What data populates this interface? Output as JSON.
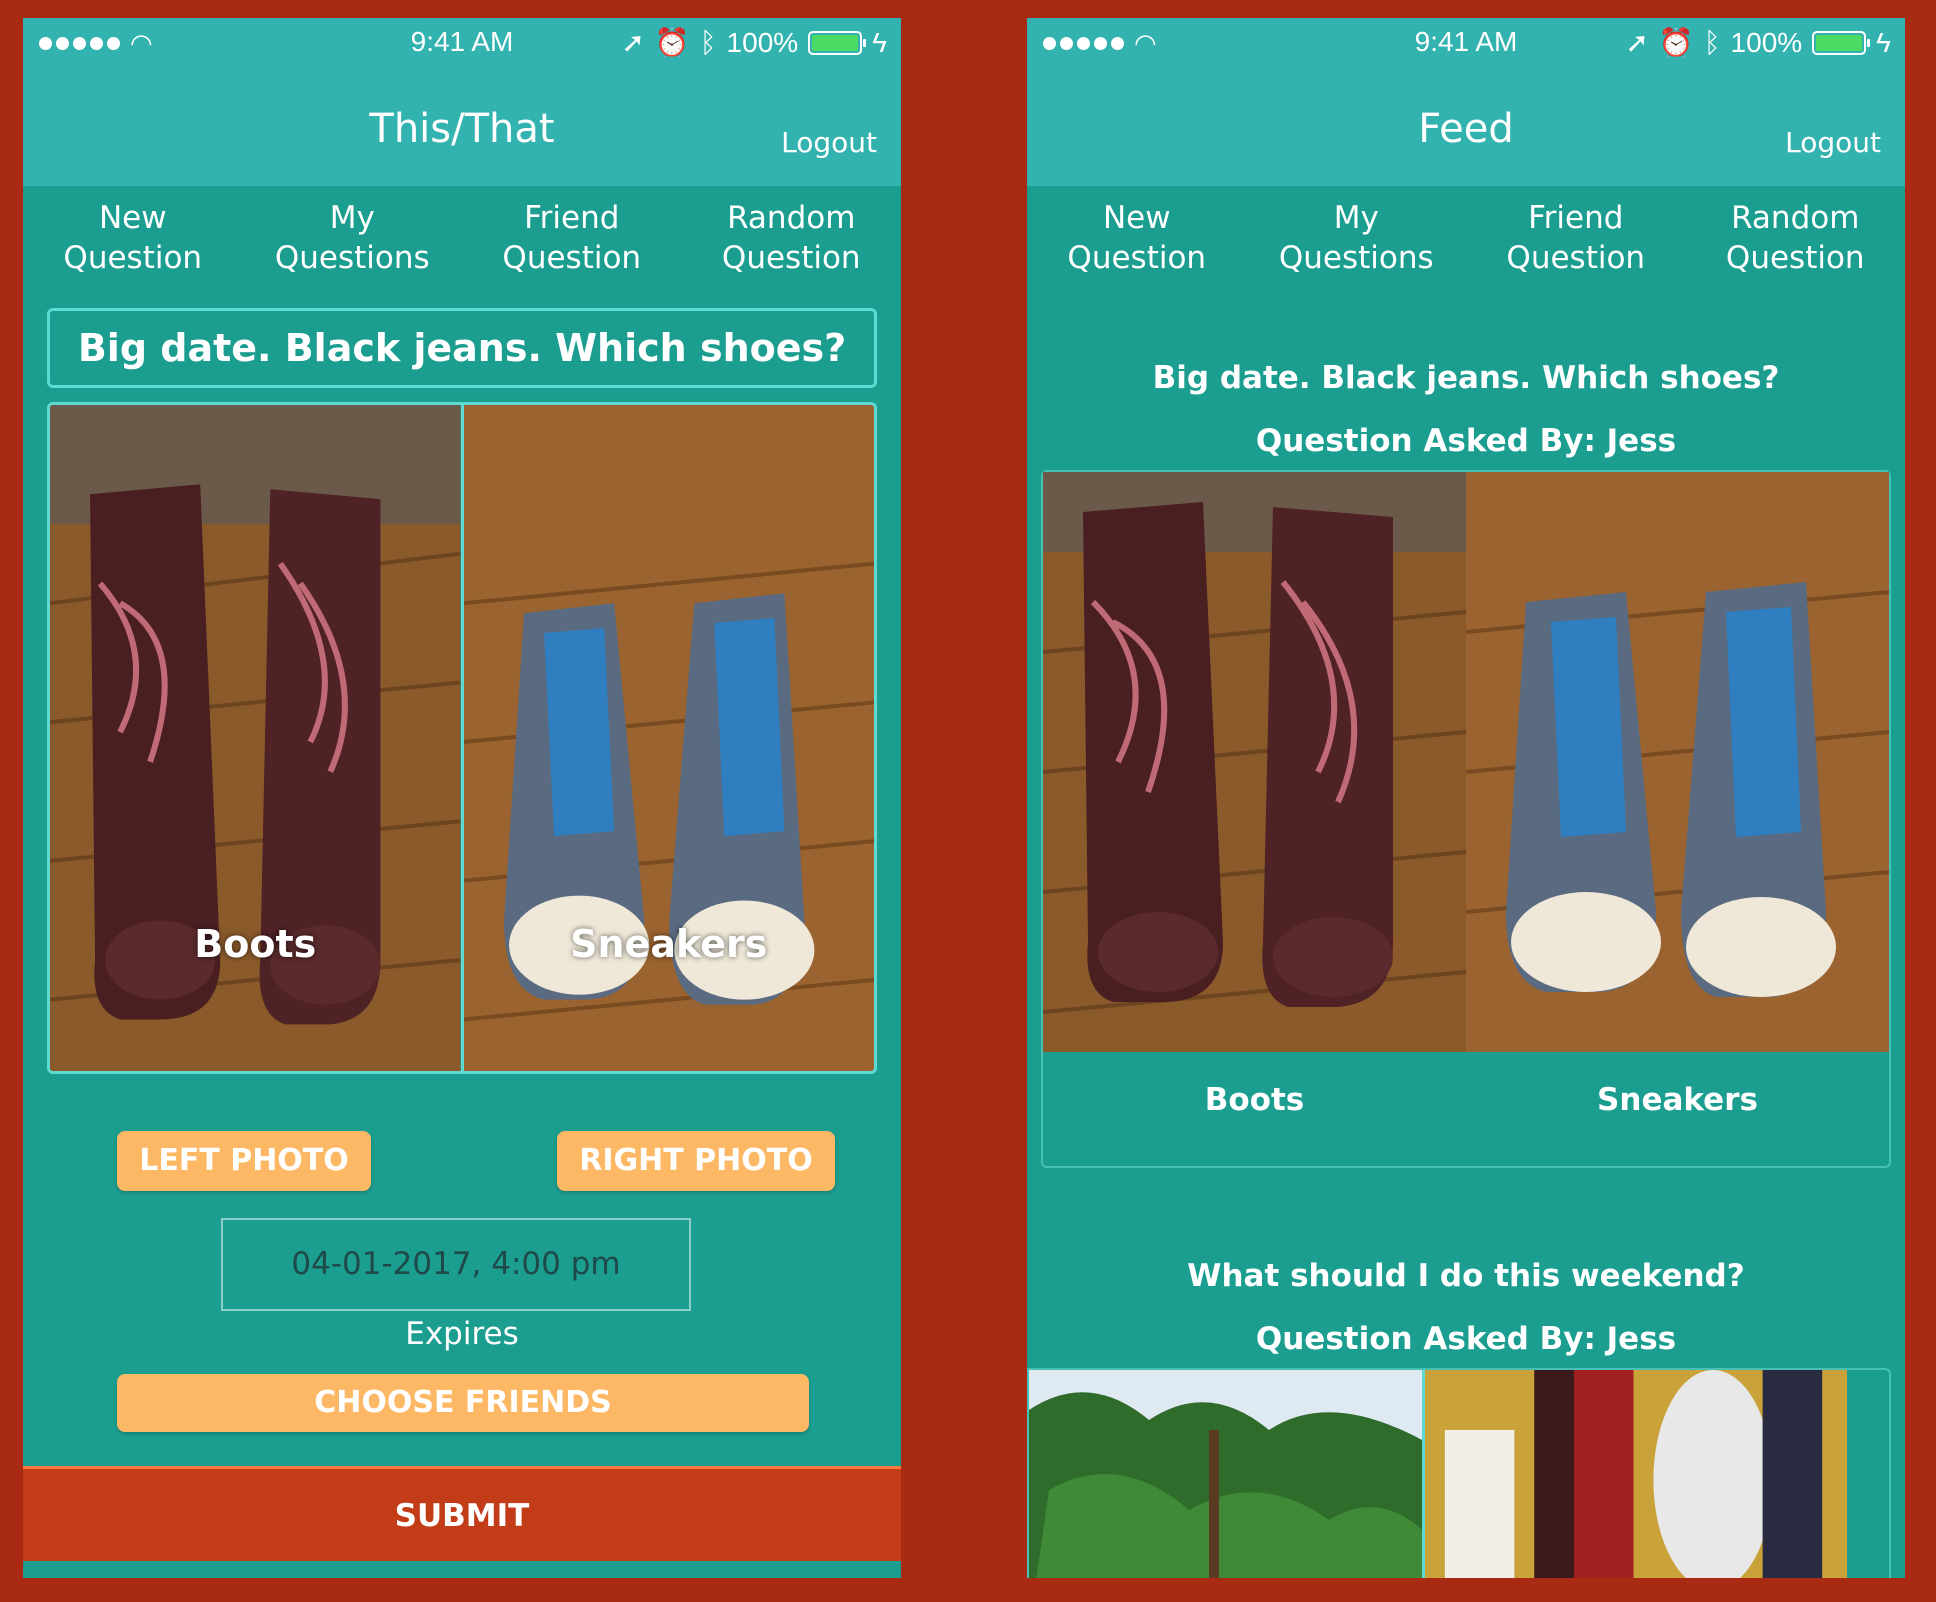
{
  "colors": {
    "background": "#a82a12",
    "header": "#33b3b0",
    "body": "#1b9e90",
    "accent_button": "#fdb866",
    "submit_bar": "#c23c17",
    "battery": "#4cd964"
  },
  "status_bar": {
    "time": "9:41 AM",
    "battery_percent": "100%"
  },
  "tabs": [
    {
      "line1": "New",
      "line2": "Question"
    },
    {
      "line1": "My",
      "line2": "Questions"
    },
    {
      "line1": "Friend",
      "line2": "Question"
    },
    {
      "line1": "Random",
      "line2": "Question"
    }
  ],
  "left_screen": {
    "title": "This/That",
    "logout_label": "Logout",
    "question": "Big date. Black jeans. Which shoes?",
    "left_photo_caption": "Boots",
    "right_photo_caption": "Sneakers",
    "left_photo_button": "LEFT PHOTO",
    "right_photo_button": "RIGHT PHOTO",
    "expiry_value": "04-01-2017, 4:00 pm",
    "expiry_label": "Expires",
    "choose_friends_button": "CHOOSE FRIENDS",
    "submit_button": "SUBMIT"
  },
  "right_screen": {
    "title": "Feed",
    "logout_label": "Logout",
    "feed": [
      {
        "question": "Big date. Black jeans. Which shoes?",
        "asked_by": "Question Asked By: Jess",
        "left_caption": "Boots",
        "right_caption": "Sneakers"
      },
      {
        "question": "What should I do this weekend?",
        "asked_by": "Question Asked By: Jess"
      }
    ]
  }
}
